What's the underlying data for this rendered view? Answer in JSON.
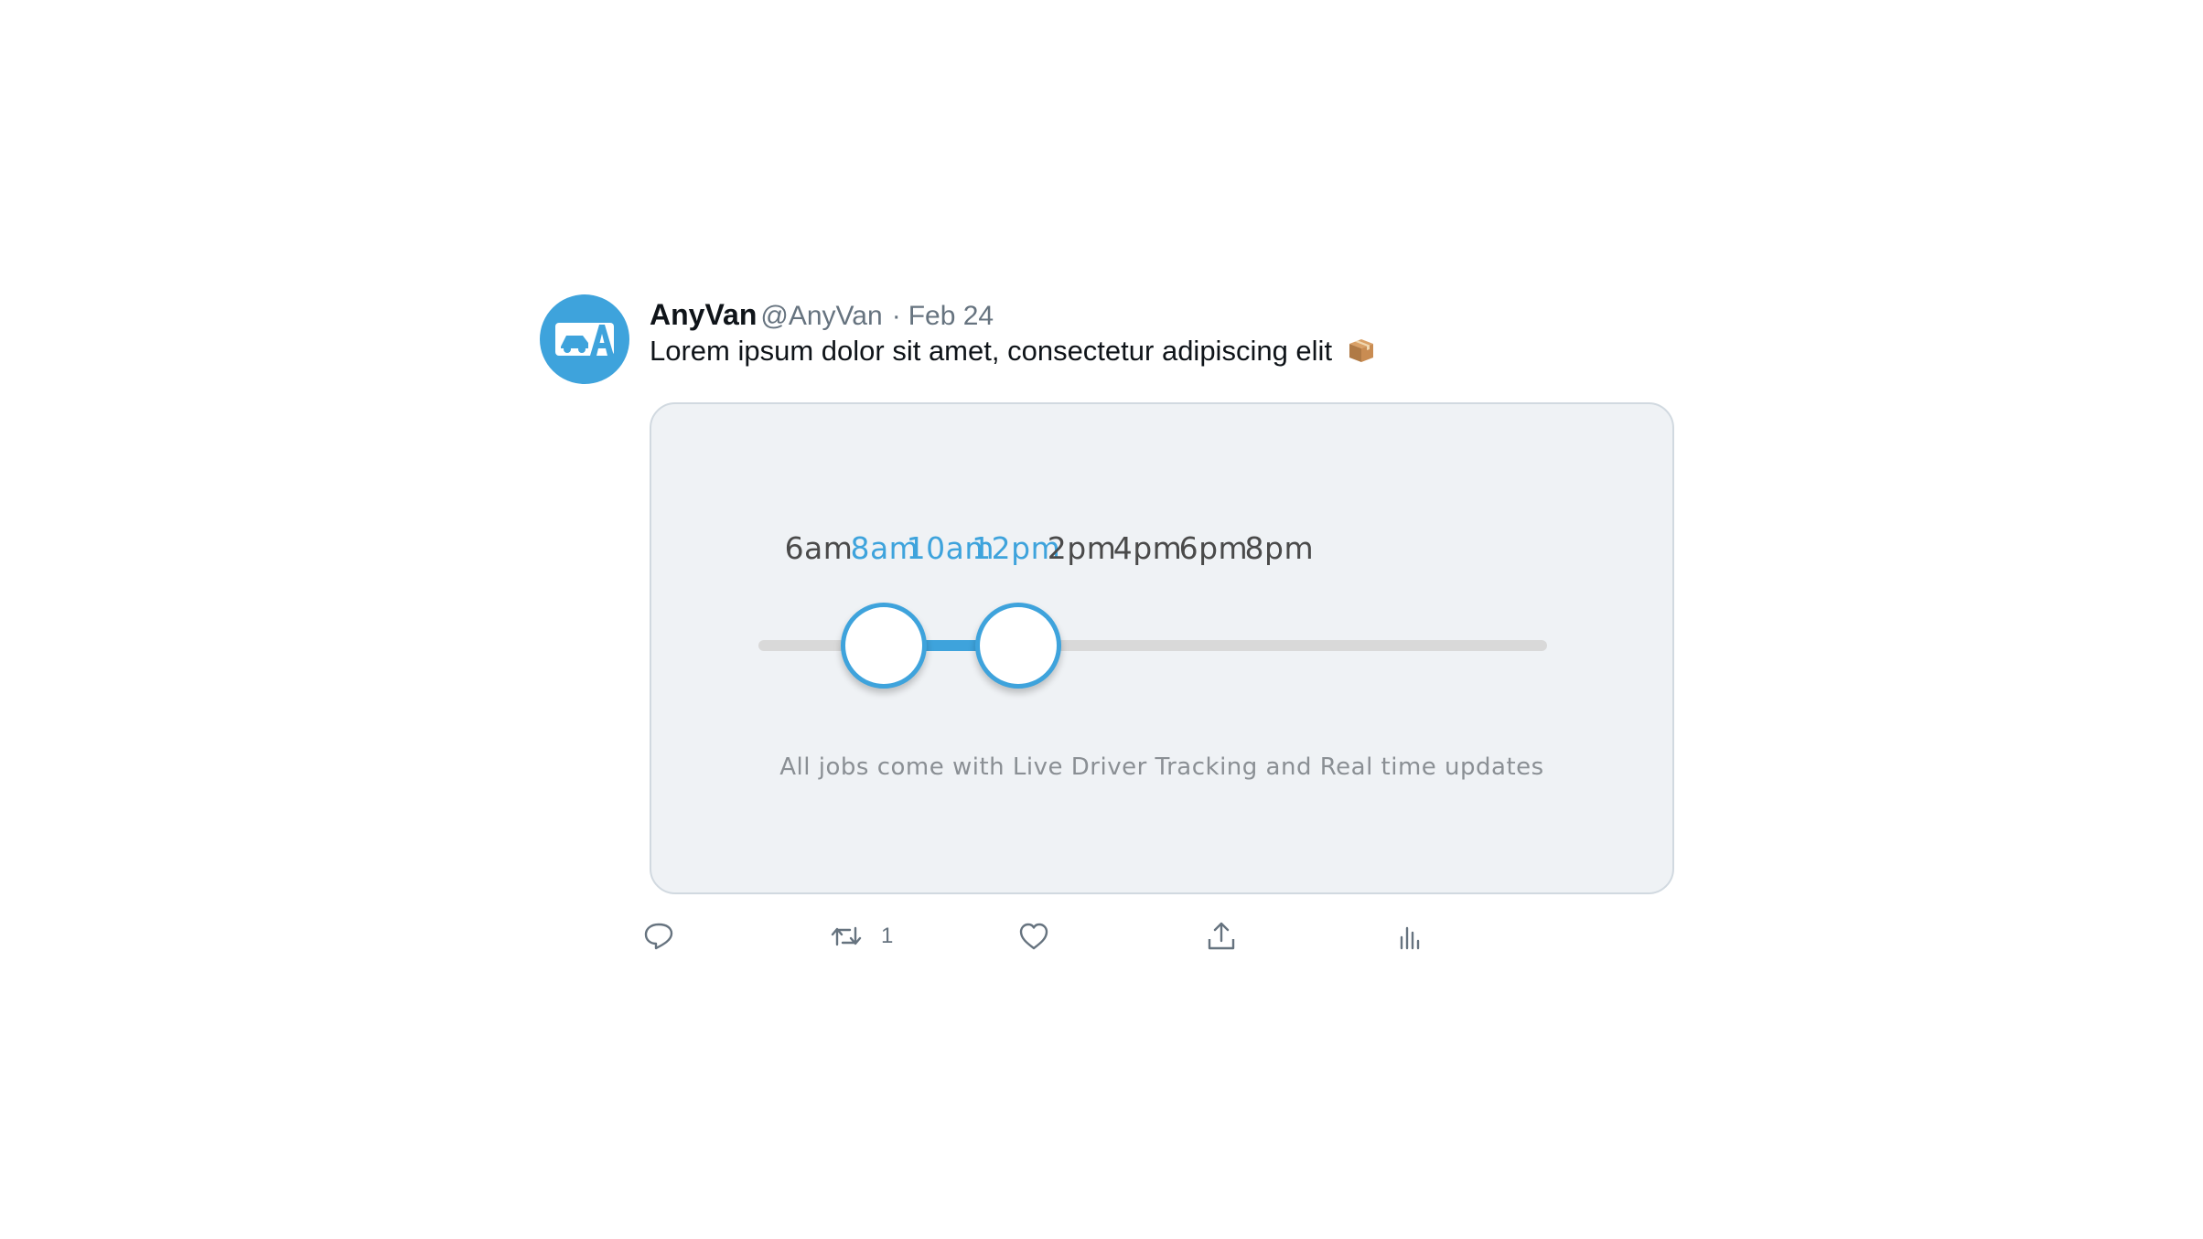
{
  "tweet": {
    "display_name": "AnyVan",
    "handle": "@AnyVan",
    "separator": "·",
    "date": "Feb 24",
    "text": "Lorem ipsum dolor sit amet, consectetur adipiscing elit",
    "text_emoji": "package-icon",
    "avatar_icon": "anyvan-logo-icon",
    "accent_color": "#3ea3dc"
  },
  "card": {
    "time_labels": [
      "6am",
      "8am",
      "10am",
      "12pm",
      "2pm",
      "4pm",
      "6pm",
      "8pm"
    ],
    "selected_range": {
      "start": "8am",
      "end": "12pm"
    },
    "caption": "All jobs come with Live Driver Tracking and Real time updates"
  },
  "actions": [
    {
      "name": "reply",
      "icon": "reply-icon",
      "count": ""
    },
    {
      "name": "retweet",
      "icon": "retweet-icon",
      "count": "1"
    },
    {
      "name": "like",
      "icon": "heart-icon",
      "count": ""
    },
    {
      "name": "share",
      "icon": "share-icon",
      "count": ""
    },
    {
      "name": "analytics",
      "icon": "analytics-icon",
      "count": ""
    }
  ]
}
